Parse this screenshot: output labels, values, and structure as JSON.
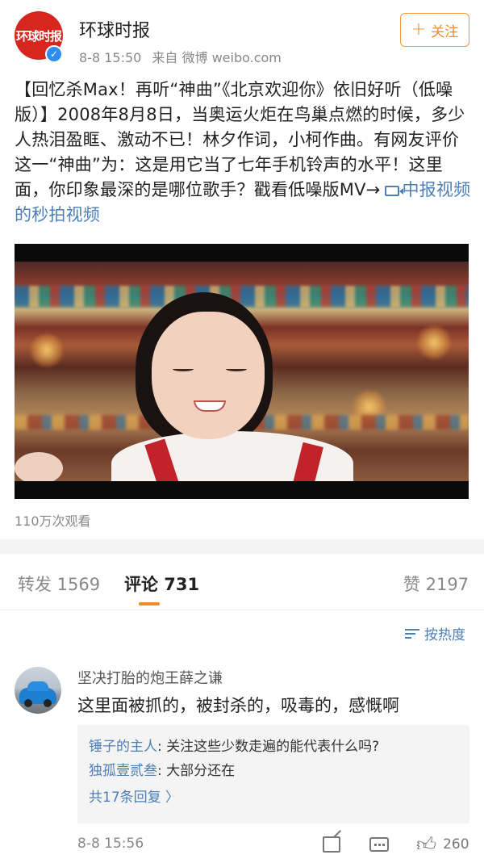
{
  "post": {
    "author": "环球时报",
    "avatar_text": "环球时报",
    "time": "8-8 15:50",
    "source": "来自 微博 weibo.com",
    "follow_label": "关注",
    "text": "【回忆杀Max！再听“神曲”《北京欢迎你》依旧好听（低噪版）】2008年8月8日，当奥运火炬在鸟巢点燃的时候，多少人热泪盈眶、激动不已！林夕作词，小柯作曲。有网友评价这一“神曲”为：这是用它当了七年手机铃声的水平！这里面，你印象最深的是哪位歌手？戳看低噪版MV→",
    "link_text": "中报视频的秒拍视频",
    "views": "110万次观看"
  },
  "tabs": {
    "repost": "转发 1569",
    "comments": "评论 731",
    "likes": "赞 2197"
  },
  "sort_label": "按热度",
  "comment": {
    "user": "坚决打胎的炮王薛之谦",
    "text": "这里面被抓的，被封杀的，吸毒的，感慨啊",
    "replies": [
      {
        "user": "锤子的主人",
        "text": ": 关注这些少数走遍的能代表什么吗?"
      },
      {
        "user": "独孤壹贰叁",
        "text": ": 大部分还在"
      }
    ],
    "more_replies": "共17条回复 〉",
    "time": "8-8 15:56",
    "like_count": "260"
  },
  "colors": {
    "accent_orange": "#f08a24",
    "link_blue": "#4e7fb5",
    "brand_red": "#d7261e"
  },
  "icons": [
    "verified-icon",
    "plus-icon",
    "video-link-icon",
    "sort-icon",
    "share-icon",
    "comment-icon",
    "like-icon"
  ]
}
